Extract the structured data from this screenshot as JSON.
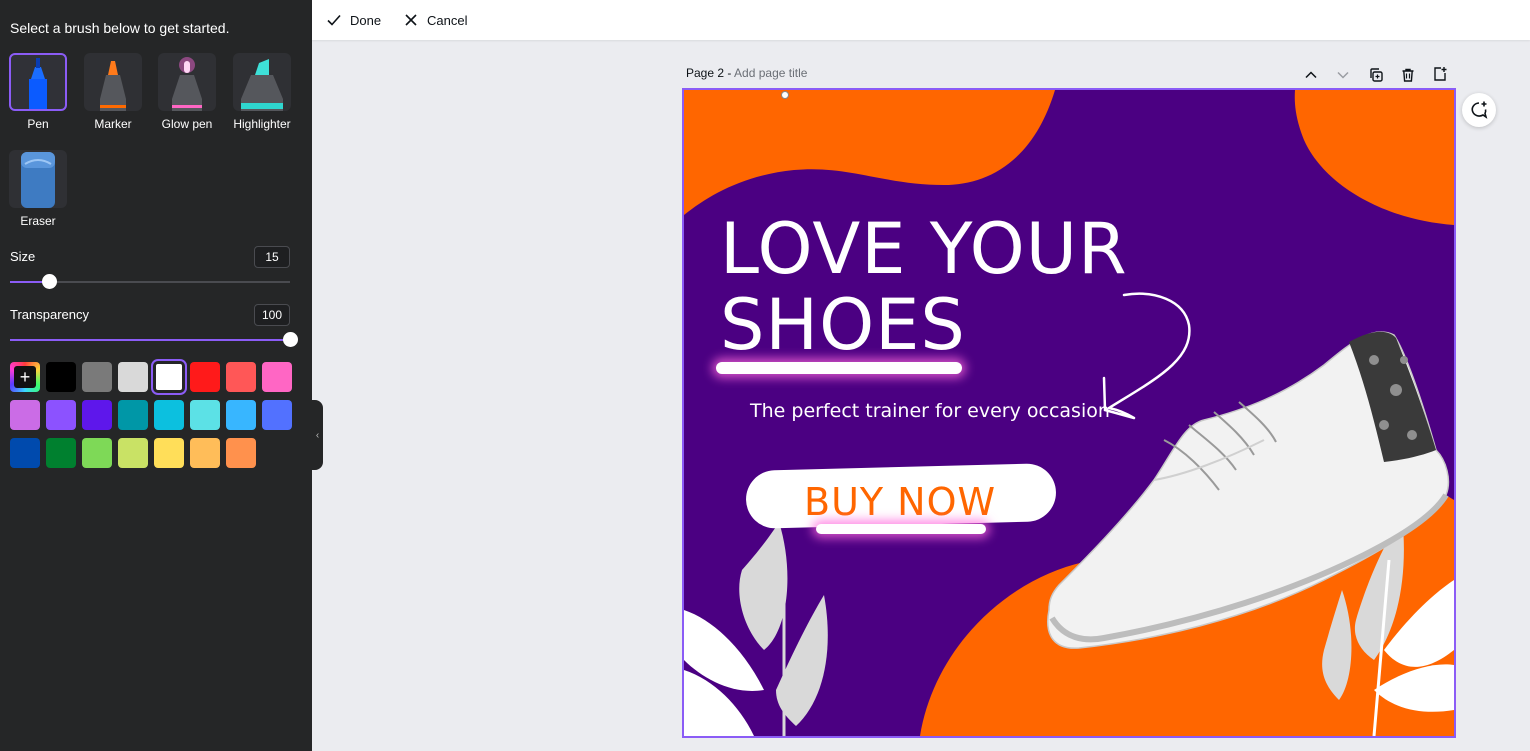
{
  "sidebar": {
    "intro": "Select a brush below to get started.",
    "brushes": [
      {
        "label": "Pen",
        "selected": true
      },
      {
        "label": "Marker",
        "selected": false
      },
      {
        "label": "Glow pen",
        "selected": false
      },
      {
        "label": "Highlighter",
        "selected": false
      },
      {
        "label": "Eraser",
        "selected": false
      }
    ],
    "size": {
      "label": "Size",
      "value": "15"
    },
    "transparency": {
      "label": "Transparency",
      "value": "100"
    },
    "colors": [
      "#000000",
      "#7a7a7a",
      "#d9d9d9",
      "#ffffff",
      "#ff1a1a",
      "#ff5757",
      "#ff66c4",
      "#cb6ce6",
      "#8c52ff",
      "#5e17eb",
      "#0097a7",
      "#0cc0df",
      "#5ce1e6",
      "#38b6ff",
      "#5271ff",
      "#004aad",
      "#00802f",
      "#7ed957",
      "#c9e265",
      "#ffde59",
      "#ffbd59",
      "#ff914d"
    ],
    "selected_color": "#ffffff",
    "accent": "#8b5cf6"
  },
  "topbar": {
    "done_label": "Done",
    "cancel_label": "Cancel"
  },
  "page": {
    "label": "Page 2 -",
    "title_placeholder": "Add page title"
  },
  "design": {
    "headline_line1": "LOVE YOUR",
    "headline_line2": "SHOES",
    "tagline": "The perfect trainer for every occasion",
    "cta": "BUY NOW",
    "bg_color": "#4b0082",
    "shape_color": "#ff6600"
  }
}
